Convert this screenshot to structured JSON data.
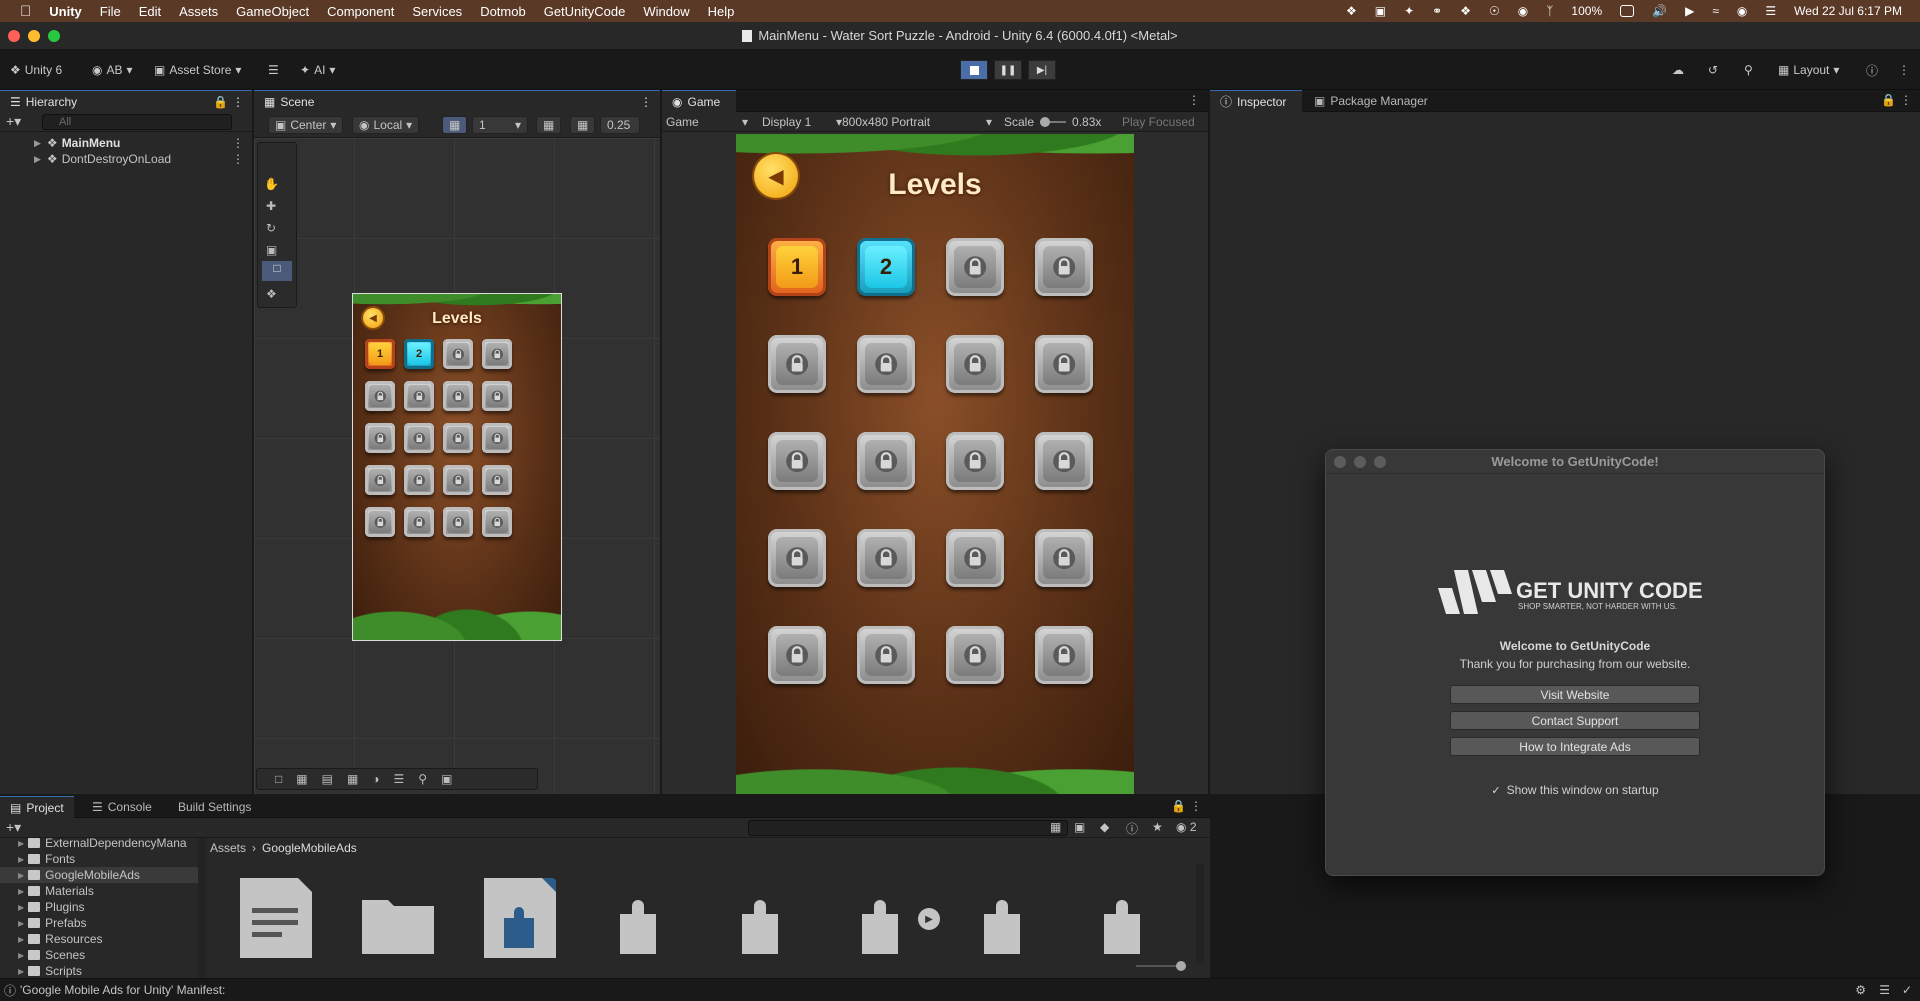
{
  "menubar": {
    "app": "Unity",
    "items": [
      "File",
      "Edit",
      "Assets",
      "GameObject",
      "Component",
      "Services",
      "Dotmob",
      "GetUnityCode",
      "Window",
      "Help"
    ],
    "battery": "100%",
    "datetime": "Wed 22 Jul  6:17 PM"
  },
  "window": {
    "title": "MainMenu - Water Sort Puzzle - Android - Unity 6.4 (6000.4.0f1) <Metal>"
  },
  "toolbar": {
    "unity_label": "Unity 6",
    "account": "AB",
    "asset_store": "Asset Store",
    "ai": "AI",
    "layout": "Layout"
  },
  "hierarchy": {
    "tab": "Hierarchy",
    "search_placeholder": "All",
    "items": [
      "MainMenu",
      "DontDestroyOnLoad"
    ]
  },
  "scene": {
    "tab": "Scene",
    "pivot": "Center",
    "space": "Local",
    "grid_value": "1",
    "snap_value": "0.25"
  },
  "game": {
    "tab": "Game",
    "mode": "Game",
    "display": "Display 1",
    "resolution": "800x480 Portrait",
    "scale_label": "Scale",
    "scale_value": "0.83x",
    "play_focused": "Play Focused",
    "screen_title": "Levels",
    "unlocked_levels": [
      "1",
      "2"
    ],
    "total_levels": 20
  },
  "inspector": {
    "tab": "Inspector",
    "tab2": "Package Manager"
  },
  "welcome_modal": {
    "title": "Welcome to GetUnityCode!",
    "logo_text": "GET UNITY CODE",
    "logo_tagline": "SHOP SMARTER, NOT HARDER WITH US.",
    "heading": "Welcome to GetUnityCode",
    "subheading": "Thank you for purchasing from our website.",
    "buttons": [
      "Visit Website",
      "Contact Support",
      "How to Integrate Ads"
    ],
    "checkbox_label": "Show this window on startup",
    "checkbox_checked": true
  },
  "project": {
    "tabs": [
      "Project",
      "Console",
      "Build Settings"
    ],
    "folders": [
      "ExternalDependencyMana",
      "Fonts",
      "GoogleMobileAds",
      "Materials",
      "Plugins",
      "Prefabs",
      "Resources",
      "Scenes",
      "Scripts"
    ],
    "breadcrumb": [
      "Assets",
      "GoogleMobileAds"
    ],
    "hidden_count": "2"
  },
  "statusbar": {
    "message": "'Google Mobile Ads for Unity' Manifest:"
  },
  "colors": {
    "menubar_bg": "#5a3a26",
    "editor_bg": "#282828",
    "accent": "#3a6cb0"
  }
}
